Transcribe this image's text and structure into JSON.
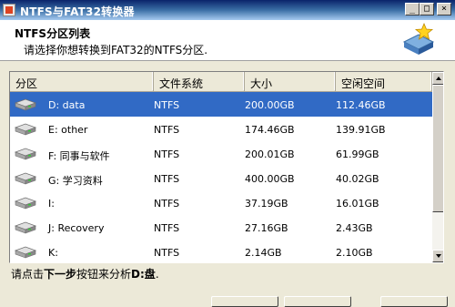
{
  "window": {
    "title": "NTFS与FAT32转换器",
    "controls": {
      "minimize": "_",
      "maximize": "□",
      "close": "×"
    }
  },
  "header": {
    "title": "NTFS分区列表",
    "subtitle": "请选择你想转换到FAT32的NTFS分区."
  },
  "table": {
    "columns": [
      "分区",
      "文件系统",
      "大小",
      "空闲空间"
    ],
    "rows": [
      {
        "partition": "D: data",
        "fs": "NTFS",
        "size": "200.00GB",
        "free": "112.46GB",
        "selected": true
      },
      {
        "partition": "E: other",
        "fs": "NTFS",
        "size": "174.46GB",
        "free": "139.91GB",
        "selected": false
      },
      {
        "partition": "F: 同事与软件",
        "fs": "NTFS",
        "size": "200.01GB",
        "free": "61.99GB",
        "selected": false
      },
      {
        "partition": "G: 学习资料",
        "fs": "NTFS",
        "size": "400.00GB",
        "free": "40.02GB",
        "selected": false
      },
      {
        "partition": "I:",
        "fs": "NTFS",
        "size": "37.19GB",
        "free": "16.01GB",
        "selected": false
      },
      {
        "partition": "J: Recovery",
        "fs": "NTFS",
        "size": "27.16GB",
        "free": "2.43GB",
        "selected": false
      },
      {
        "partition": "K:",
        "fs": "NTFS",
        "size": "2.14GB",
        "free": "2.10GB",
        "selected": false
      }
    ]
  },
  "footer": {
    "text_prefix": "请点击",
    "text_bold": "下一步",
    "text_middle": "按钮来分析",
    "text_drive": "D:盘",
    "text_end": "."
  },
  "colors": {
    "selection": "#316ac5",
    "titlebar": "#0a246a",
    "face": "#ece9d8"
  }
}
